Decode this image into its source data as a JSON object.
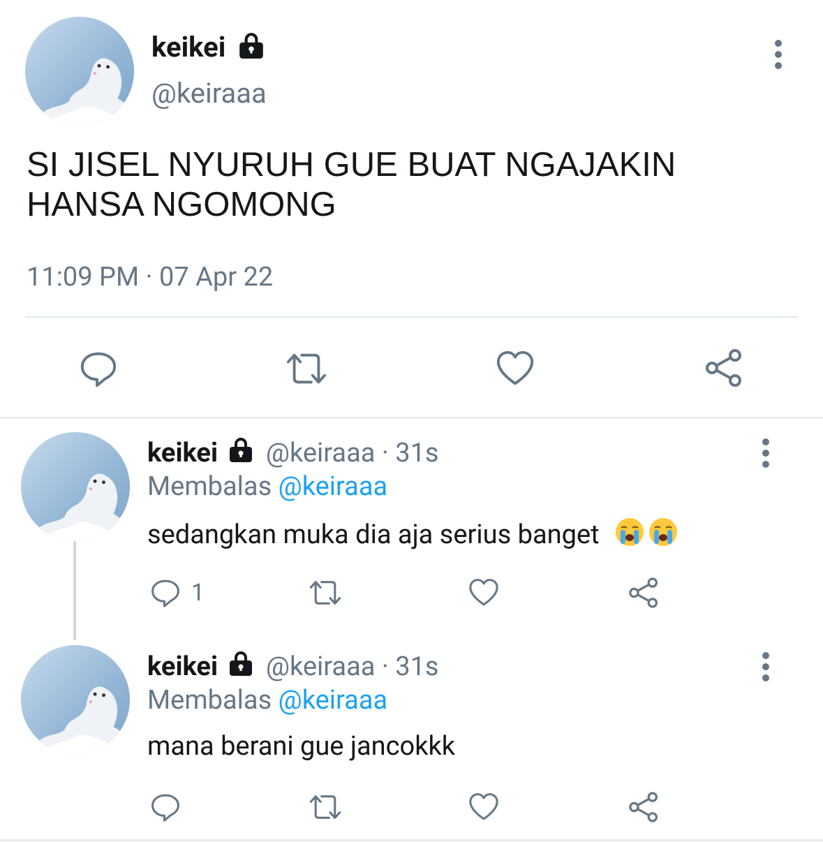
{
  "main_tweet": {
    "display_name": "keikei",
    "handle": "@keiraaa",
    "text_line1": "SI JISEL NYURUH GUE BUAT NGAJAKIN",
    "text_line2": "HANSA NGOMONG",
    "timestamp": "11:09 PM · 07 Apr 22"
  },
  "replies": [
    {
      "display_name": "keikei",
      "handle_time": "@keiraaa · 31s",
      "replying_prefix": "Membalas",
      "replying_to": "@keiraaa",
      "text": "sedangkan muka dia aja serius banget",
      "emojis": [
        "loudly-crying-face",
        "loudly-crying-face"
      ],
      "reply_count": "1"
    },
    {
      "display_name": "keikei",
      "handle_time": "@keiraaa · 31s",
      "replying_prefix": "Membalas",
      "replying_to": "@keiraaa",
      "text": "mana berani gue jancokkk",
      "reply_count": ""
    }
  ],
  "colors": {
    "text_primary": "#14171a",
    "text_secondary": "#657786",
    "link": "#1da1f2",
    "divider": "#e1e8ed"
  },
  "icons": [
    "lock-icon",
    "more-vertical-icon",
    "reply-icon",
    "retweet-icon",
    "like-icon",
    "share-icon"
  ]
}
